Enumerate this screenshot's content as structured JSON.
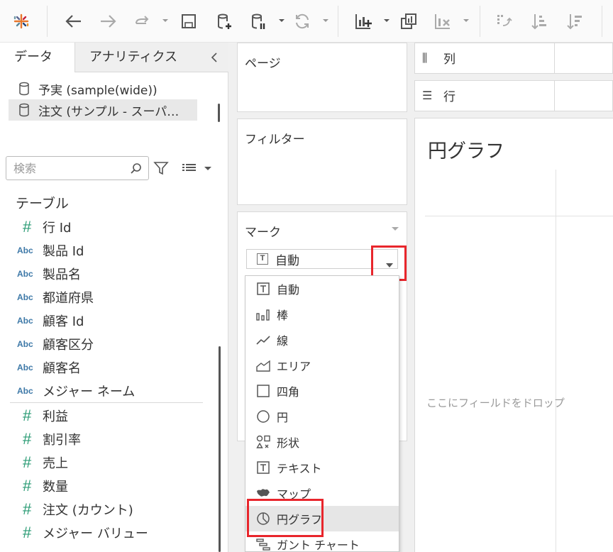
{
  "toolbar": {
    "icons": [
      "tableau-logo-icon",
      "back-icon",
      "forward-icon",
      "redo-icon",
      "save-icon",
      "new-datasource-icon",
      "pause-datasource-icon",
      "refresh-icon",
      "new-worksheet-icon",
      "duplicate-sheet-icon",
      "clear-sheet-icon",
      "swap-icon",
      "sort-ascending-icon",
      "sort-descending-icon"
    ]
  },
  "data_pane": {
    "tab_data": "データ",
    "tab_analytics": "アナリティクス",
    "datasources": [
      {
        "label": "予実 (sample(wide))",
        "selected": false
      },
      {
        "label": "注文 (サンプル - スーパ…",
        "selected": true
      }
    ],
    "search_placeholder": "検索",
    "section_title": "テーブル",
    "fields": [
      {
        "type": "#",
        "label": "行 Id"
      },
      {
        "type": "Abc",
        "label": "製品 Id"
      },
      {
        "type": "Abc",
        "label": "製品名"
      },
      {
        "type": "Abc",
        "label": "都道府県"
      },
      {
        "type": "Abc",
        "label": "顧客 Id"
      },
      {
        "type": "Abc",
        "label": "顧客区分"
      },
      {
        "type": "Abc",
        "label": "顧客名"
      },
      {
        "type": "Abc",
        "label": "メジャー ネーム"
      },
      {
        "type": "#",
        "label": "利益"
      },
      {
        "type": "#",
        "label": "割引率"
      },
      {
        "type": "#",
        "label": "売上"
      },
      {
        "type": "#",
        "label": "数量"
      },
      {
        "type": "#",
        "label": "注文 (カウント)"
      },
      {
        "type": "#",
        "label": "メジャー バリュー"
      }
    ]
  },
  "shelves": {
    "pages": "ページ",
    "filters": "フィルター",
    "marks": "マーク",
    "columns": "列",
    "rows": "行"
  },
  "marks_card": {
    "current_type": "自動",
    "type_icon": "T",
    "options": [
      {
        "label": "自動",
        "icon": "auto-icon"
      },
      {
        "label": "棒",
        "icon": "bar-icon"
      },
      {
        "label": "線",
        "icon": "line-icon"
      },
      {
        "label": "エリア",
        "icon": "area-icon"
      },
      {
        "label": "四角",
        "icon": "square-icon"
      },
      {
        "label": "円",
        "icon": "circle-icon"
      },
      {
        "label": "形状",
        "icon": "shape-icon"
      },
      {
        "label": "テキスト",
        "icon": "text-icon"
      },
      {
        "label": "マップ",
        "icon": "map-icon"
      },
      {
        "label": "円グラフ",
        "icon": "pie-icon"
      },
      {
        "label": "ガント チャート",
        "icon": "gantt-icon"
      }
    ],
    "selected_option": "円グラフ"
  },
  "sheet": {
    "title": "円グラフ",
    "drop_hint": "ここにフィールドをドロップ"
  },
  "colors": {
    "highlight": "#e8262c",
    "dimension": "#3e79a8",
    "measure": "#2a9b74"
  }
}
